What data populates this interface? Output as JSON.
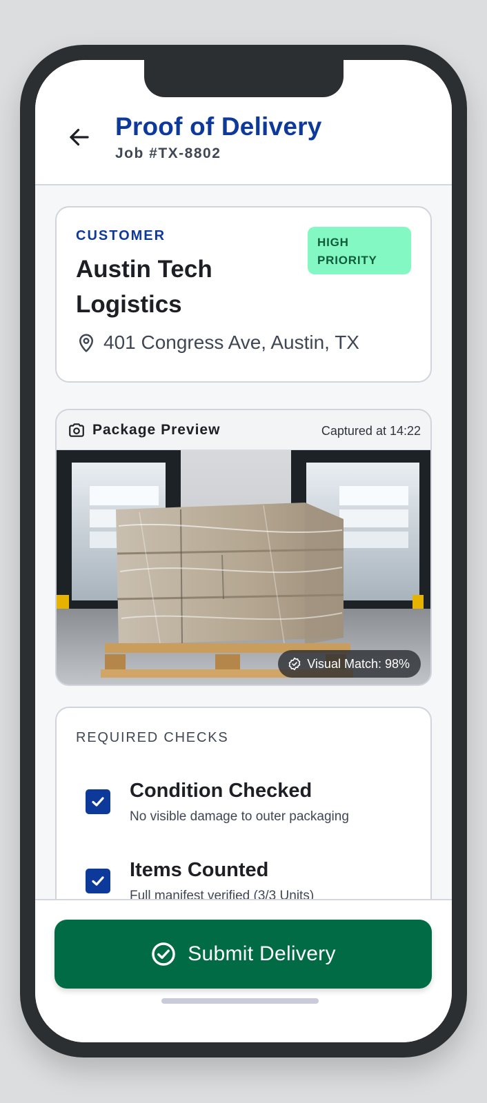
{
  "header": {
    "title": "Proof of Delivery",
    "job_id": "Job #TX-8802",
    "back_icon": "arrow-left-icon"
  },
  "customer": {
    "label": "CUSTOMER",
    "name": "Austin Tech Logistics",
    "priority_badge": "HIGH PRIORITY",
    "address": "401 Congress Ave, Austin, TX",
    "address_icon": "map-pin-icon"
  },
  "preview": {
    "title": "Package Preview",
    "captured": "Captured at 14:22",
    "visual_match": "Visual Match: 98%",
    "camera_icon": "camera-icon",
    "badge_icon": "verified-badge-icon"
  },
  "checks": {
    "label": "REQUIRED CHECKS",
    "items": [
      {
        "title": "Condition Checked",
        "description": "No visible damage to outer packaging",
        "checked": true
      },
      {
        "title": "Items Counted",
        "description": "Full manifest verified (3/3 Units)",
        "checked": true
      }
    ]
  },
  "footer": {
    "submit_label": "Submit Delivery",
    "submit_icon": "check-circle-icon"
  },
  "colors": {
    "brand_blue": "#0d3a9a",
    "submit_green": "#006b45",
    "priority_bg": "#84f8c2",
    "priority_text": "#0f5b3b"
  }
}
